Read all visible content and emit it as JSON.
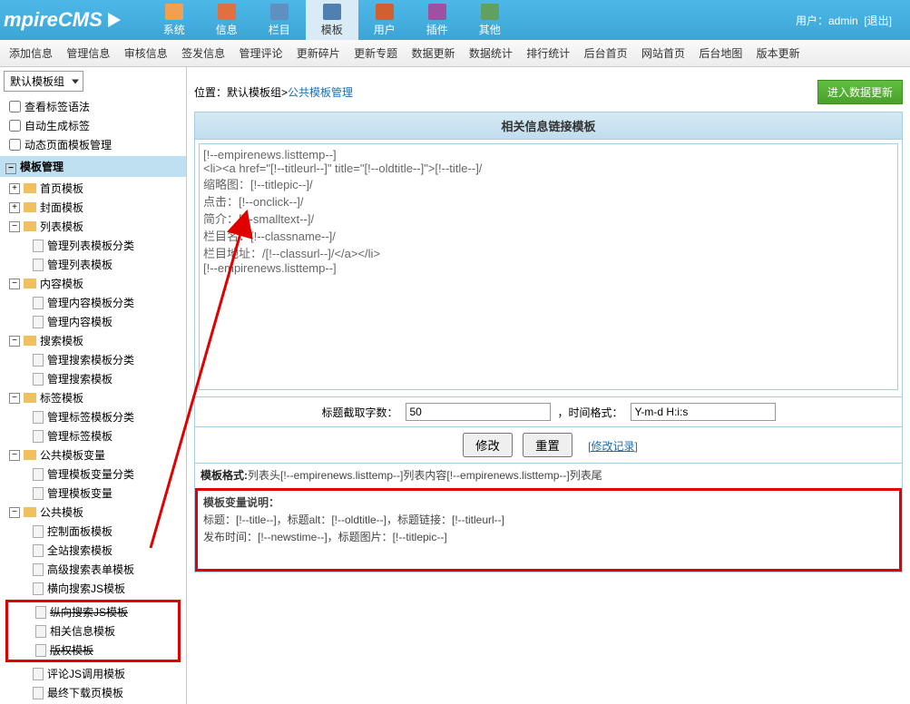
{
  "header": {
    "logo": "mpireCMS",
    "menu": [
      "系统",
      "信息",
      "栏目",
      "模板",
      "用户",
      "插件",
      "其他"
    ],
    "user_label": "用户：",
    "user_name": "admin",
    "logout": "[退出]"
  },
  "subnav": [
    "添加信息",
    "管理信息",
    "审核信息",
    "签发信息",
    "管理评论",
    "更新碎片",
    "更新专题",
    "数据更新",
    "数据统计",
    "排行统计",
    "后台首页",
    "网站首页",
    "后台地图",
    "版本更新"
  ],
  "sidebar": {
    "combo": "默认模板组",
    "root_items": [
      "查看标签语法",
      "自动生成标签",
      "动态页面模板管理"
    ],
    "section_head": "模板管理",
    "groups": [
      {
        "label": "首页模板",
        "type": "leaf"
      },
      {
        "label": "封面模板",
        "type": "leaf"
      },
      {
        "label": "列表模板",
        "type": "branch",
        "children": [
          "管理列表模板分类",
          "管理列表模板"
        ]
      },
      {
        "label": "内容模板",
        "type": "branch",
        "children": [
          "管理内容模板分类",
          "管理内容模板"
        ]
      },
      {
        "label": "搜索模板",
        "type": "branch",
        "children": [
          "管理搜索模板分类",
          "管理搜索模板"
        ]
      },
      {
        "label": "标签模板",
        "type": "branch",
        "children": [
          "管理标签模板分类",
          "管理标签模板"
        ]
      },
      {
        "label": "公共模板变量",
        "type": "branch",
        "children": [
          "管理模板变量分类",
          "管理模板变量"
        ]
      },
      {
        "label": "公共模板",
        "type": "branch",
        "children": [
          "控制面板模板",
          "全站搜索模板",
          "高级搜索表单模板",
          "横向搜索JS模板",
          "纵向搜索JS模板",
          "相关信息模板",
          "版权模板",
          "评论JS调用模板",
          "最终下载页模板"
        ]
      }
    ]
  },
  "content": {
    "breadcrumb_label": "位置：",
    "breadcrumb_l1": "默认模板组",
    "breadcrumb_sep": " > ",
    "breadcrumb_l2": "公共模板管理",
    "btn_update": "进入数据更新",
    "panel_title": "相关信息链接模板",
    "code": "[!--empirenews.listtemp--]\n<li><a href=\"[!--titleurl--]\" title=\"[!--oldtitle--]\">[!--title--]/\n缩略图：[!--titlepic--]/\n点击：[!--onclick--]/\n简介：[!--smalltext--]/\n栏目名：[!--classname--]/\n栏目地址：/[!--classurl--]/</a></li>\n[!--empirenews.listtemp--]",
    "label_chars": "标题截取字数：",
    "val_chars": "50",
    "label_time": "，时间格式：",
    "val_time": "Y-m-d H:i:s",
    "btn_modify": "修改",
    "btn_reset": "重置",
    "link_history": "[修改记录]",
    "format_label": "模板格式:",
    "format_text": "列表头[!--empirenews.listtemp--]列表内容[!--empirenews.listtemp--]列表尾",
    "vars_label": "模板变量说明：",
    "vars_line1": "标题：[!--title--]，标题alt：[!--oldtitle--]，标题链接：[!--titleurl--]",
    "vars_line2": "发布时间：[!--newstime--]，标题图片：[!--titlepic--]"
  }
}
